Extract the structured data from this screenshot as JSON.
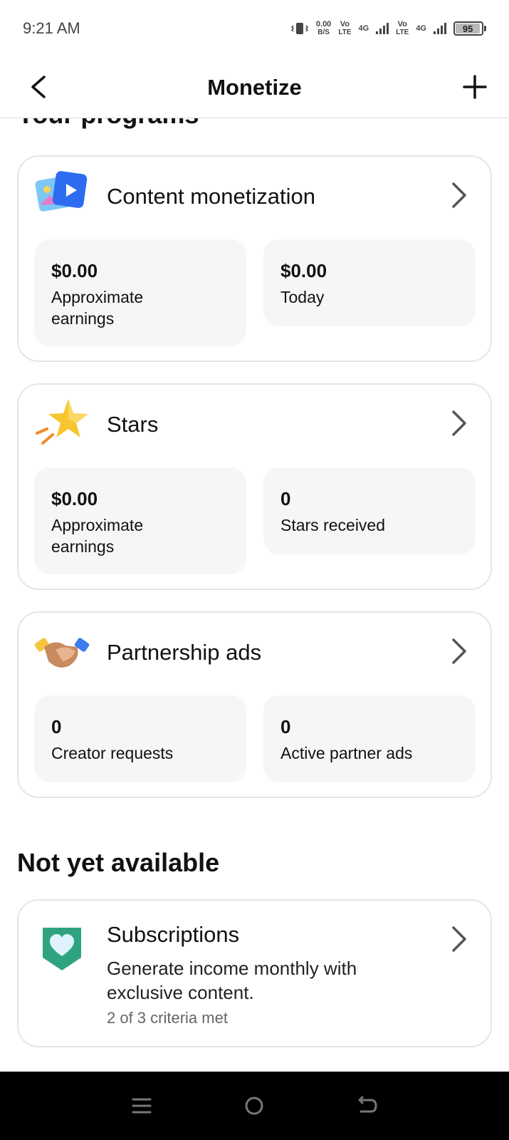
{
  "status_bar": {
    "time": "9:21 AM",
    "data_speed": "0.00",
    "data_unit": "B/S",
    "sim1_volte_top": "Vo",
    "sim1_volte_bottom": "LTE",
    "sim1_network": "4G",
    "sim2_volte_top": "Vo",
    "sim2_volte_bottom": "LTE",
    "sim2_network": "4G",
    "battery": "95",
    "battery_level": 0.95
  },
  "header": {
    "title": "Monetize"
  },
  "programs": {
    "section_title": "Your programs",
    "cards": [
      {
        "title": "Content monetization",
        "icon": "photo-video-icon",
        "stats": [
          {
            "value": "$0.00",
            "label": "Approximate earnings"
          },
          {
            "value": "$0.00",
            "label": "Today"
          }
        ]
      },
      {
        "title": "Stars",
        "icon": "star-icon",
        "stats": [
          {
            "value": "$0.00",
            "label": "Approximate earnings"
          },
          {
            "value": "0",
            "label": "Stars received"
          }
        ]
      },
      {
        "title": "Partnership ads",
        "icon": "handshake-icon",
        "stats": [
          {
            "value": "0",
            "label": "Creator requests"
          },
          {
            "value": "0",
            "label": "Active partner ads"
          }
        ]
      }
    ]
  },
  "not_available": {
    "section_title": "Not yet available",
    "subscriptions": {
      "title": "Subscriptions",
      "description": "Generate income monthly with exclusive content.",
      "meta": "2 of 3 criteria met",
      "icon": "heart-badge-icon"
    }
  },
  "colors": {
    "card_border": "#e4e6eb",
    "stat_bg": "#f5f6f8",
    "subscription_green": "#2fa37f"
  }
}
